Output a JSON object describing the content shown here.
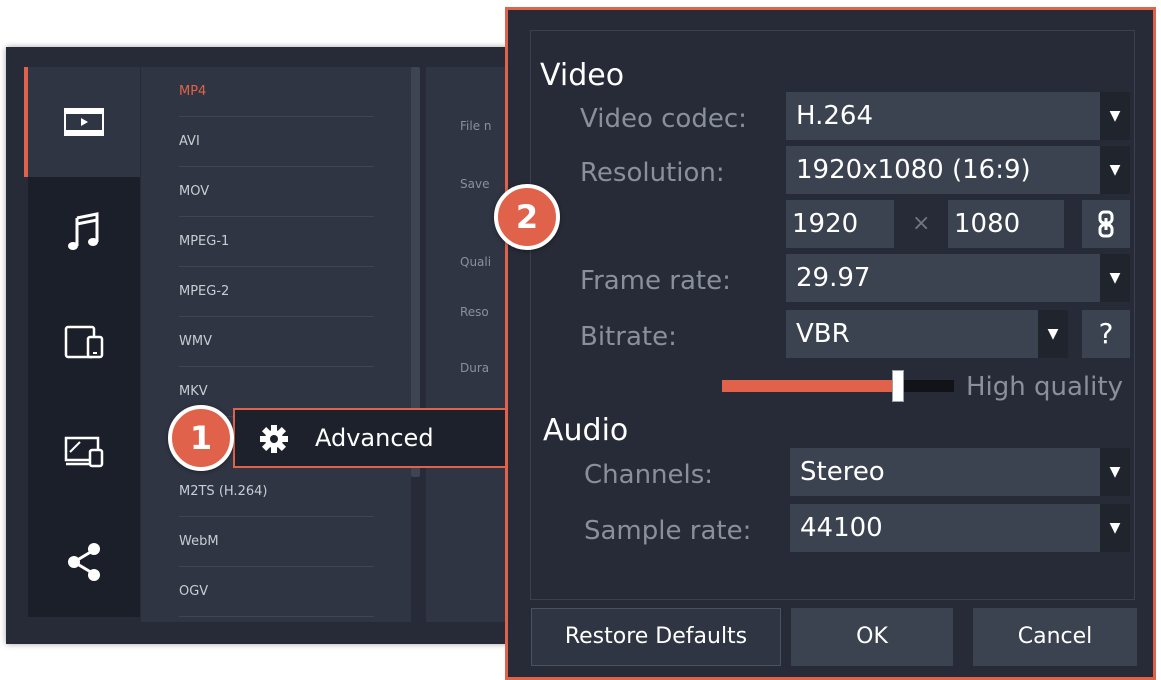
{
  "export_window": {
    "categories": [
      {
        "name": "video",
        "icon": "film-icon",
        "active": true
      },
      {
        "name": "audio",
        "icon": "music-note-icon",
        "active": false
      },
      {
        "name": "devices",
        "icon": "devices-icon",
        "active": false
      },
      {
        "name": "tv",
        "icon": "tv-devices-icon",
        "active": false
      },
      {
        "name": "share",
        "icon": "share-icon",
        "active": false
      }
    ],
    "formats": [
      "MP4",
      "AVI",
      "MOV",
      "MPEG-1",
      "MPEG-2",
      "WMV",
      "MKV",
      "M2TS (H.264)",
      "WebM",
      "OGV"
    ],
    "active_format": "MP4",
    "side_labels": [
      "File n",
      "Save",
      "Quali",
      "Reso",
      "Dura"
    ],
    "advanced_label": "Advanced"
  },
  "markers": {
    "step1": "1",
    "step2": "2"
  },
  "dialog": {
    "video_title": "Video",
    "video_codec_label": "Video codec:",
    "video_codec_value": "H.264",
    "resolution_label": "Resolution:",
    "resolution_value": "1920x1080 (16:9)",
    "width_value": "1920",
    "times_symbol": "×",
    "height_value": "1080",
    "frame_rate_label": "Frame rate:",
    "frame_rate_value": "29.97",
    "bitrate_label": "Bitrate:",
    "bitrate_value": "VBR",
    "help_symbol": "?",
    "quality_label": "High quality",
    "quality_level": 0.76,
    "audio_title": "Audio",
    "channels_label": "Channels:",
    "channels_value": "Stereo",
    "sample_rate_label": "Sample rate:",
    "sample_rate_value": "44100",
    "arrow_glyph": "▼",
    "restore_label": "Restore Defaults",
    "ok_label": "OK",
    "cancel_label": "Cancel"
  },
  "colors": {
    "accent": "#e1624a",
    "panel": "#262b37",
    "field": "#3b4250",
    "muted_text": "#8a909b"
  }
}
